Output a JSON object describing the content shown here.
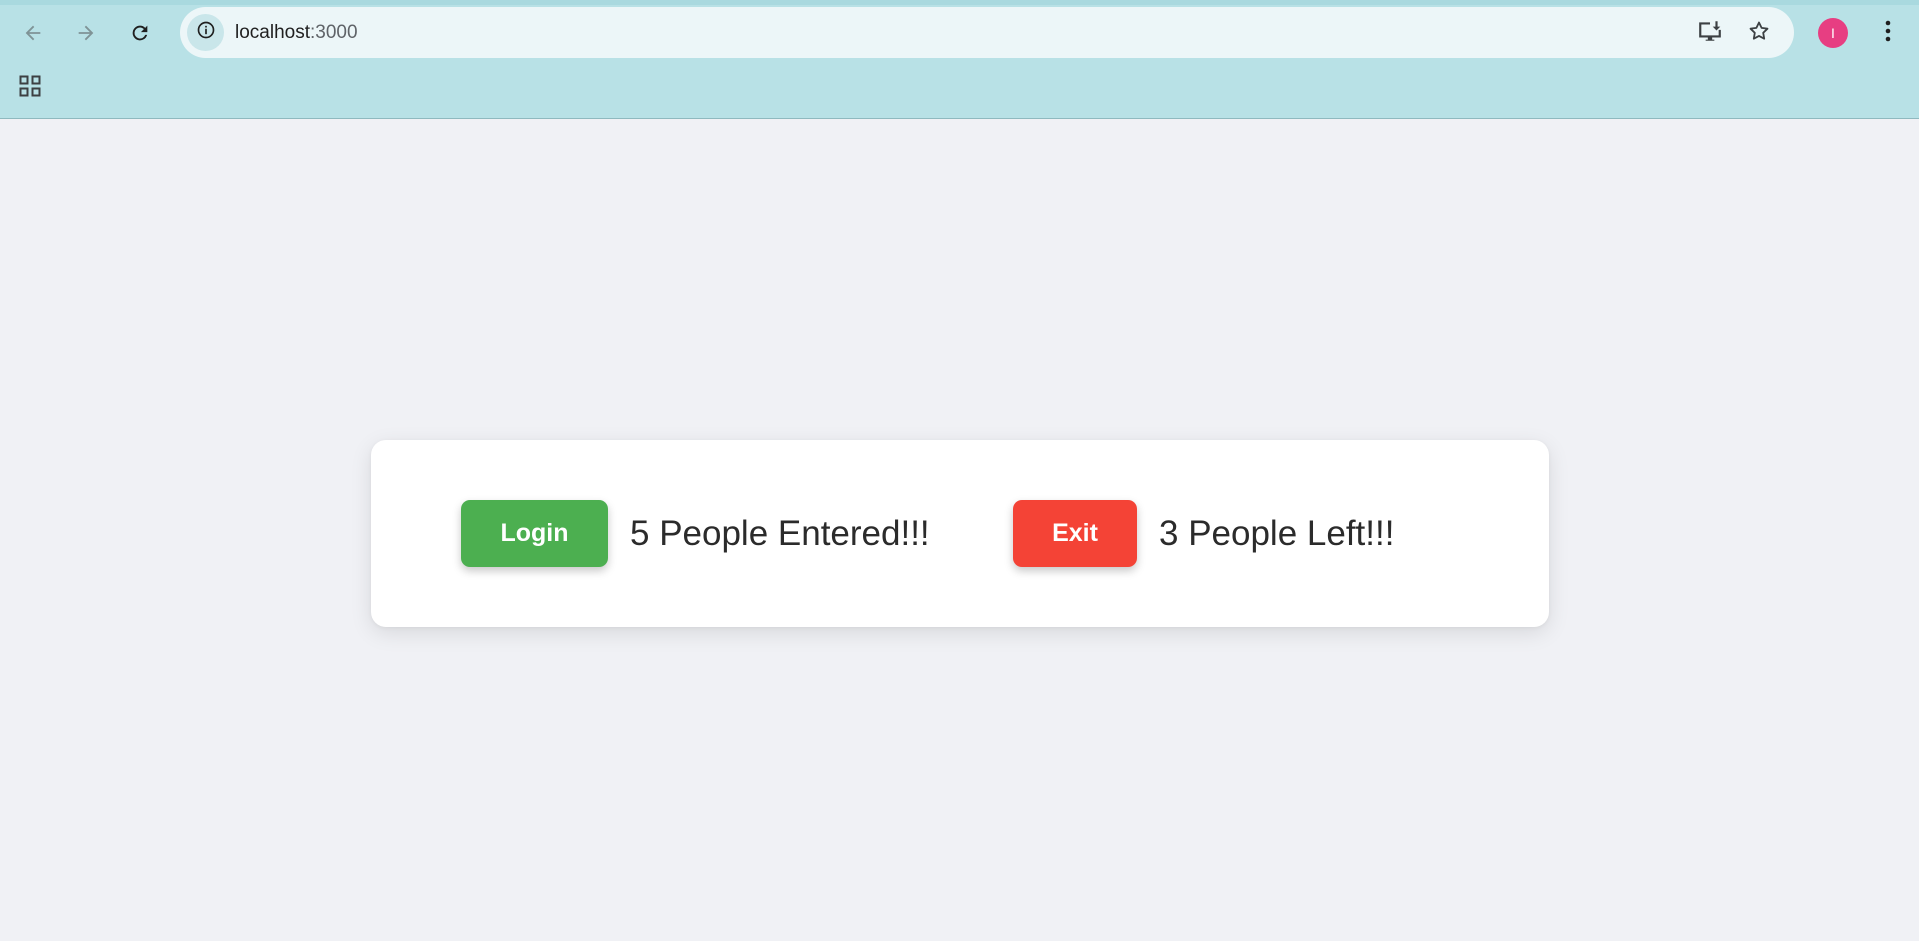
{
  "browser": {
    "url_host": "localhost",
    "url_port": ":3000",
    "profile_initial": "I",
    "icons": {
      "back": "arrow-left-icon",
      "forward": "arrow-right-icon",
      "reload": "reload-icon",
      "site_info": "info-icon",
      "install": "install-app-icon",
      "bookmark": "star-icon",
      "menu": "kebab-menu-icon",
      "apps": "apps-grid-icon"
    },
    "colors": {
      "toolbar": "#b8e1e6",
      "omnibox": "#ecf6f8",
      "avatar": "#e73e82"
    }
  },
  "app": {
    "login_button_label": "Login",
    "entered_text": "5 People Entered!!!",
    "exit_button_label": "Exit",
    "left_text": "3 People Left!!!",
    "colors": {
      "login_button": "#4caf50",
      "exit_button": "#f44336",
      "page_background": "#f0f1f5",
      "card_background": "#ffffff"
    }
  }
}
